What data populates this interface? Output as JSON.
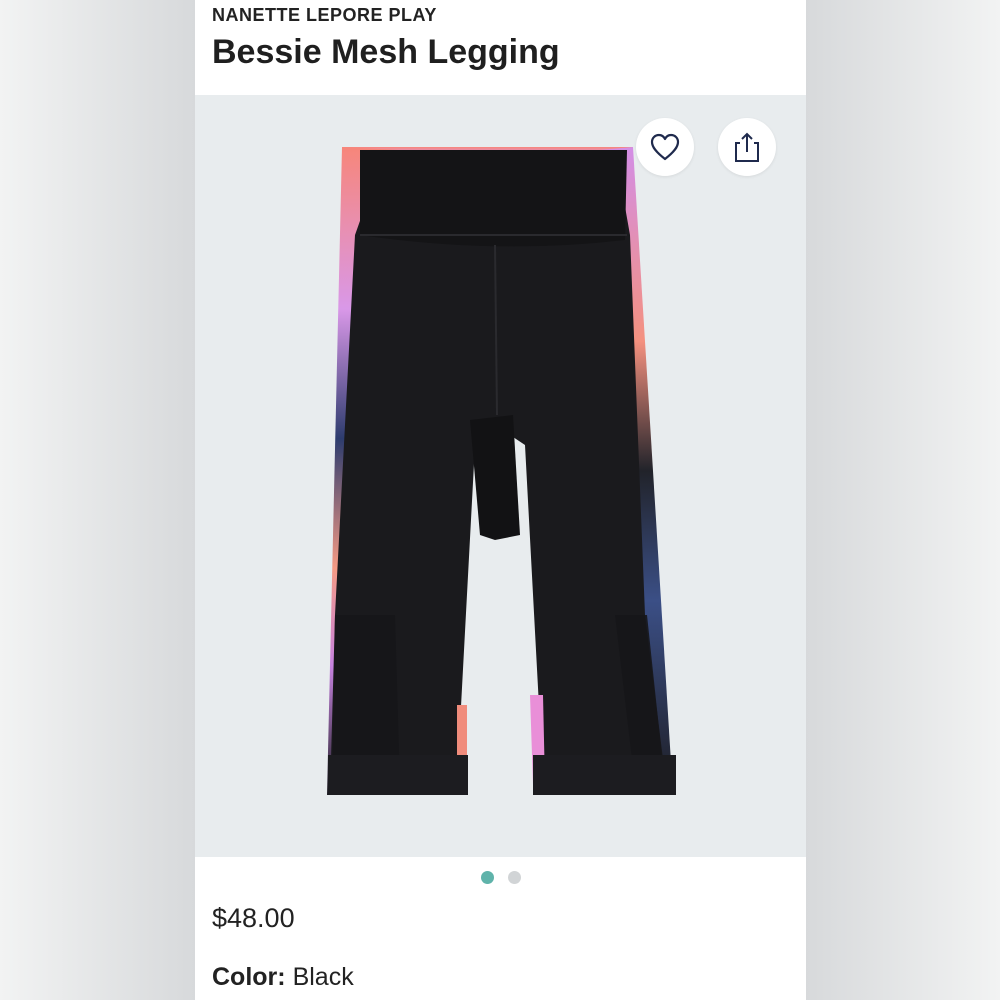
{
  "product": {
    "brand": "NANETTE LEPORE PLAY",
    "title": "Bessie Mesh Legging",
    "price": "$48.00",
    "color_label": "Color:",
    "color_value": "Black"
  },
  "image": {
    "description_icon": "product-photo",
    "carousel": {
      "total": 2,
      "active_index": 0
    }
  },
  "actions": {
    "favorite_icon": "heart-icon",
    "share_icon": "share-icon"
  },
  "colors": {
    "accent": "#5fb3aa",
    "inactive_dot": "#d1d4d6",
    "image_background": "#e8ecee"
  }
}
